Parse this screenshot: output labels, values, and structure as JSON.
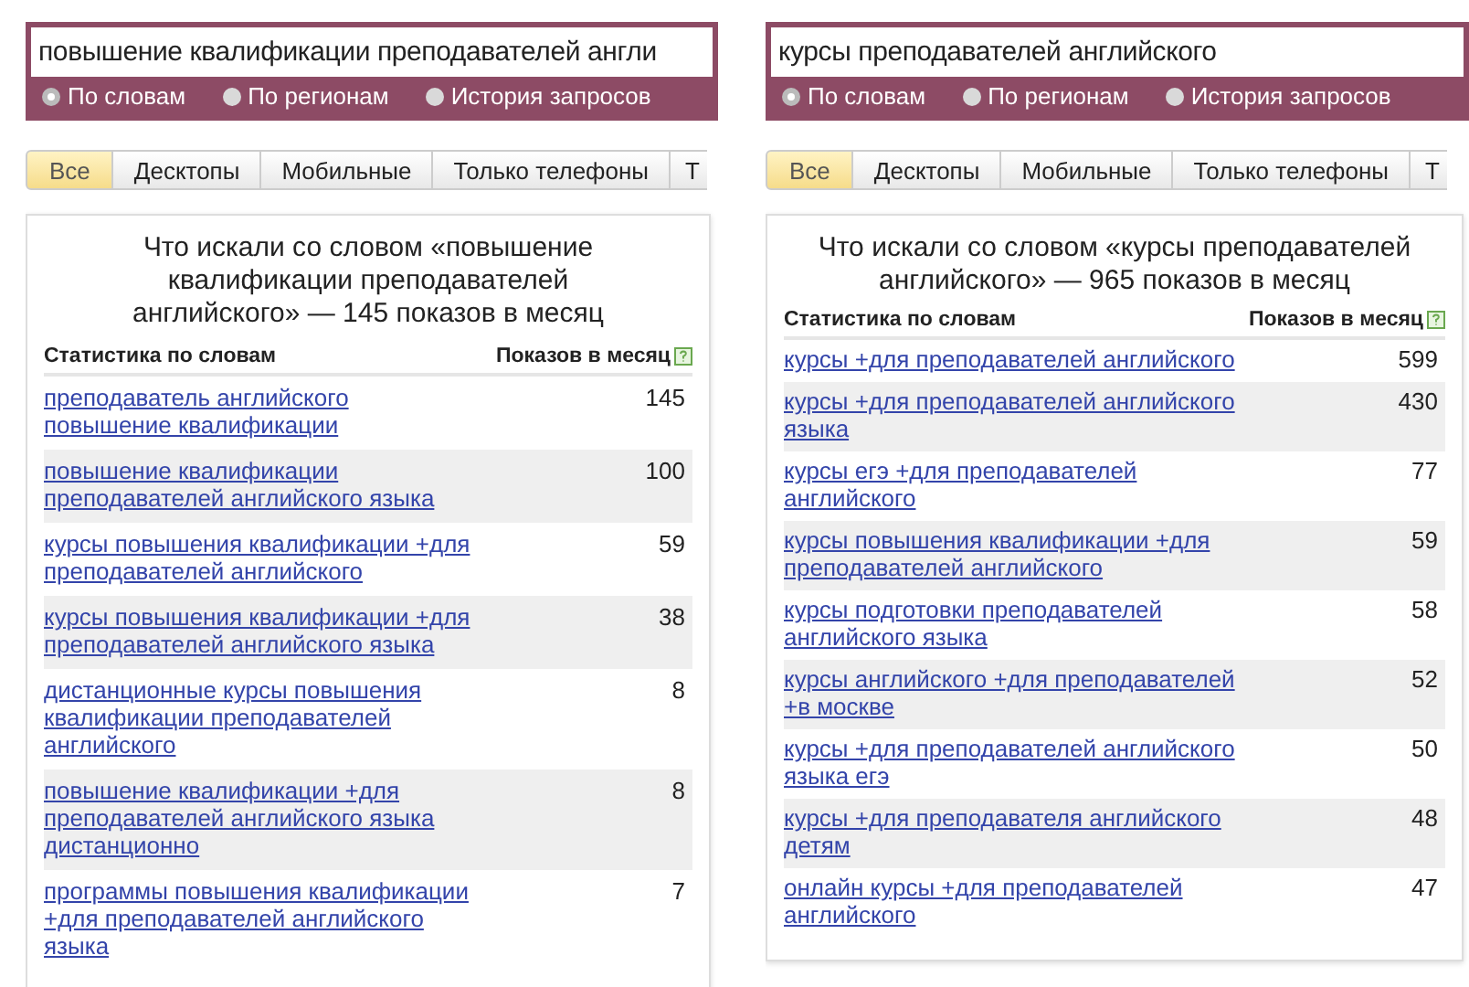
{
  "panels": [
    {
      "query": "повышение квалификации преподавателей англи",
      "radios": [
        {
          "label": "По словам",
          "selected": true
        },
        {
          "label": "По регионам",
          "selected": false
        },
        {
          "label": "История запросов",
          "selected": false
        }
      ],
      "tabs": [
        {
          "label": "Все",
          "selected": true
        },
        {
          "label": "Десктопы",
          "selected": false
        },
        {
          "label": "Мобильные",
          "selected": false
        },
        {
          "label": "Только телефоны",
          "selected": false
        },
        {
          "label": "Т",
          "selected": false
        }
      ],
      "card": {
        "title": "Что искали со словом «повышение квалификации преподавателей английского» — 145 показов в месяц",
        "columns": [
          "Статистика по словам",
          "Показов в месяц"
        ],
        "rows": [
          {
            "phrase": "преподаватель английского повышение квалификации",
            "count": "145"
          },
          {
            "phrase": "повышение квалификации преподавателей английского языка",
            "count": "100"
          },
          {
            "phrase": "курсы повышения квалификации +для преподавателей английского",
            "count": "59"
          },
          {
            "phrase": "курсы повышения квалификации +для преподавателей английского языка",
            "count": "38"
          },
          {
            "phrase": "дистанционные курсы повышения квалификации преподавателей английского",
            "count": "8"
          },
          {
            "phrase": "повышение квалификации +для преподавателей английского языка дистанционно",
            "count": "8"
          },
          {
            "phrase": "программы повышения квалификации +для преподавателей английского языка",
            "count": "7"
          }
        ]
      }
    },
    {
      "query": "курсы преподавателей английского",
      "radios": [
        {
          "label": "По словам",
          "selected": true
        },
        {
          "label": "По регионам",
          "selected": false
        },
        {
          "label": "История запросов",
          "selected": false
        }
      ],
      "tabs": [
        {
          "label": "Все",
          "selected": true
        },
        {
          "label": "Десктопы",
          "selected": false
        },
        {
          "label": "Мобильные",
          "selected": false
        },
        {
          "label": "Только телефоны",
          "selected": false
        },
        {
          "label": "Т",
          "selected": false
        }
      ],
      "card": {
        "title": "Что искали со словом «курсы преподавателей английского» — 965 показов в месяц",
        "columns": [
          "Статистика по словам",
          "Показов в месяц"
        ],
        "rows": [
          {
            "phrase": "курсы +для преподавателей английского",
            "count": "599"
          },
          {
            "phrase": "курсы +для преподавателей английского языка",
            "count": "430"
          },
          {
            "phrase": "курсы егэ +для преподавателей английского",
            "count": "77"
          },
          {
            "phrase": "курсы повышения квалификации +для преподавателей английского",
            "count": "59"
          },
          {
            "phrase": "курсы подготовки преподавателей английского языка",
            "count": "58"
          },
          {
            "phrase": "курсы английского +для преподавателей +в москве",
            "count": "52"
          },
          {
            "phrase": "курсы +для преподавателей английского языка егэ",
            "count": "50"
          },
          {
            "phrase": "курсы +для преподавателя английского детям",
            "count": "48"
          },
          {
            "phrase": "онлайн курсы +для преподавателей английского",
            "count": "47"
          }
        ]
      }
    }
  ]
}
